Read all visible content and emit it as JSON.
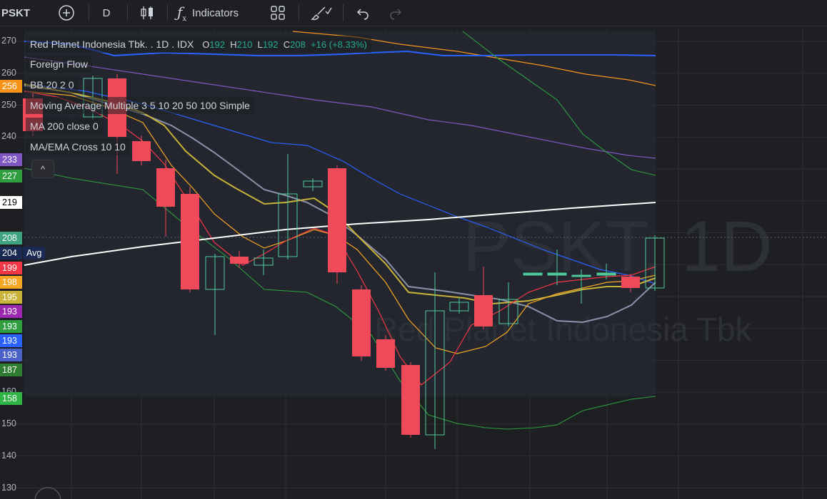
{
  "toolbar": {
    "symbol": "PSKT",
    "interval": "D",
    "indicators_label": "Indicators",
    "icons": [
      "add-symbol-icon",
      "candles-icon",
      "fx-icon",
      "layout-grid-icon",
      "drawing-brush-icon",
      "undo-icon",
      "redo-icon"
    ]
  },
  "legend": {
    "title": "Red Planet Indonesia Tbk. . 1D . IDX",
    "o_key": "O",
    "o_val": "192",
    "h_key": "H",
    "h_val": "210",
    "l_key": "L",
    "l_val": "192",
    "c_key": "C",
    "c_val": "208",
    "change": "+16 (+8.33%)",
    "rows": [
      "Foreign Flow",
      "BB 20 2 0",
      "Moving Average Multiple 3 5 10 20 50 100 Simple",
      "MA 200 close 0",
      "MA/EMA Cross 10 10"
    ],
    "collapse_glyph": "^"
  },
  "watermark": {
    "symbol": "PSKT, 1D",
    "name": "Red Planet Indonesia Tbk"
  },
  "price_axis": {
    "ticks": [
      "270",
      "260",
      "250",
      "240",
      "160",
      "150",
      "140",
      "130"
    ],
    "ticks_values": [
      270,
      260,
      250,
      240,
      160,
      150,
      140,
      130
    ],
    "tags": [
      {
        "text": "256",
        "value": 256,
        "color": "#f7931a"
      },
      {
        "text": "233",
        "value": 233,
        "color": "#7e57c2"
      },
      {
        "text": "227",
        "value": 227,
        "color": "#2e9e3f"
      },
      {
        "text": "219",
        "value": 219,
        "color": "#ffffff"
      },
      {
        "text": "208",
        "value": 208,
        "color": "#3fa37f"
      },
      {
        "text": "204",
        "value": 204,
        "color": "#1a2a52"
      },
      {
        "text": "199",
        "value": 199,
        "color": "#f23645"
      },
      {
        "text": "198",
        "value": 198,
        "color": "#f5a623"
      },
      {
        "text": "195",
        "value": 195,
        "color": "#c8b23a"
      },
      {
        "text": "193",
        "value": 193,
        "color": "#9c27b0"
      },
      {
        "text": "193",
        "value": 193,
        "color": "#2e9e3f"
      },
      {
        "text": "193",
        "value": 193,
        "color": "#2962ff"
      },
      {
        "text": "193",
        "value": 193,
        "color": "#4b63c9"
      },
      {
        "text": "187",
        "value": 187,
        "color": "#2f7d32"
      },
      {
        "text": "158",
        "value": 158,
        "color": "#2fb344"
      }
    ],
    "avg_label": "Avg"
  },
  "colors": {
    "up": "#4ec99a",
    "down": "#f04a5a",
    "grid": "#2e2f33",
    "bg": "#1e1f22"
  }
}
